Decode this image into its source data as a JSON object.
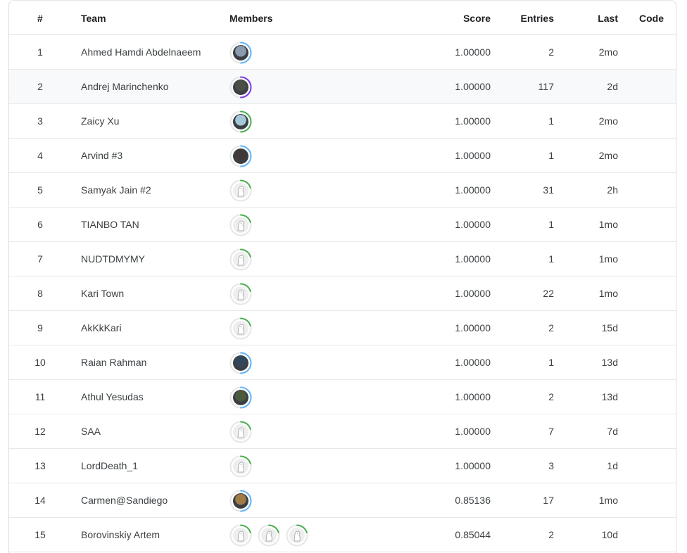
{
  "header": {
    "rank": "#",
    "team": "Team",
    "members": "Members",
    "score": "Score",
    "entries": "Entries",
    "last": "Last",
    "code": "Code"
  },
  "rows": [
    {
      "rank": "1",
      "team": "Ahmed Hamdi Abdelnaeem",
      "score": "1.00000",
      "entries": "2",
      "last": "2mo",
      "members": [
        {
          "type": "photo",
          "ring": "#64b5f6",
          "face": "#8a9bb0"
        }
      ]
    },
    {
      "rank": "2",
      "team": "Andrej Marinchenko",
      "score": "1.00000",
      "entries": "117",
      "last": "2d",
      "members": [
        {
          "type": "photo",
          "ring": "#7c3aed",
          "face": "#4a4f45"
        }
      ]
    },
    {
      "rank": "3",
      "team": "Zaicy Xu",
      "score": "1.00000",
      "entries": "1",
      "last": "2mo",
      "members": [
        {
          "type": "photo",
          "ring": "#4caf50",
          "face": "#a5c8d8"
        }
      ]
    },
    {
      "rank": "4",
      "team": "Arvind #3",
      "score": "1.00000",
      "entries": "1",
      "last": "2mo",
      "members": [
        {
          "type": "photo",
          "ring": "#64b5f6",
          "face": "#3f3a38"
        }
      ]
    },
    {
      "rank": "5",
      "team": "Samyak Jain #2",
      "score": "1.00000",
      "entries": "31",
      "last": "2h",
      "members": [
        {
          "type": "default",
          "ring": "#4caf50"
        }
      ]
    },
    {
      "rank": "6",
      "team": "TIANBO TAN",
      "score": "1.00000",
      "entries": "1",
      "last": "1mo",
      "members": [
        {
          "type": "default",
          "ring": "#4caf50"
        }
      ]
    },
    {
      "rank": "7",
      "team": "NUDTDMYMY",
      "score": "1.00000",
      "entries": "1",
      "last": "1mo",
      "members": [
        {
          "type": "default",
          "ring": "#4caf50"
        }
      ]
    },
    {
      "rank": "8",
      "team": "Kari Town",
      "score": "1.00000",
      "entries": "22",
      "last": "1mo",
      "members": [
        {
          "type": "default",
          "ring": "#4caf50"
        }
      ]
    },
    {
      "rank": "9",
      "team": "AkKkKari",
      "score": "1.00000",
      "entries": "2",
      "last": "15d",
      "members": [
        {
          "type": "default",
          "ring": "#4caf50"
        }
      ]
    },
    {
      "rank": "10",
      "team": "Raian Rahman",
      "score": "1.00000",
      "entries": "1",
      "last": "13d",
      "members": [
        {
          "type": "photo",
          "ring": "#64b5f6",
          "face": "#30465a"
        }
      ]
    },
    {
      "rank": "11",
      "team": "Athul Yesudas",
      "score": "1.00000",
      "entries": "2",
      "last": "13d",
      "members": [
        {
          "type": "photo",
          "ring": "#64b5f6",
          "face": "#4b5a3c"
        }
      ]
    },
    {
      "rank": "12",
      "team": "SAA",
      "score": "1.00000",
      "entries": "7",
      "last": "7d",
      "members": [
        {
          "type": "default",
          "ring": "#4caf50"
        }
      ]
    },
    {
      "rank": "13",
      "team": "LordDeath_1",
      "score": "1.00000",
      "entries": "3",
      "last": "1d",
      "members": [
        {
          "type": "default",
          "ring": "#4caf50"
        }
      ]
    },
    {
      "rank": "14",
      "team": "Carmen@Sandiego",
      "score": "0.85136",
      "entries": "17",
      "last": "1mo",
      "members": [
        {
          "type": "photo",
          "ring": "#64b5f6",
          "face": "#a07a48"
        }
      ]
    },
    {
      "rank": "15",
      "team": "Borovinskiy Artem",
      "score": "0.85044",
      "entries": "2",
      "last": "10d",
      "members": [
        {
          "type": "default",
          "ring": "#4caf50"
        },
        {
          "type": "default",
          "ring": "#4caf50"
        },
        {
          "type": "default",
          "ring": "#4caf50"
        }
      ]
    }
  ],
  "highlight_row": "2"
}
